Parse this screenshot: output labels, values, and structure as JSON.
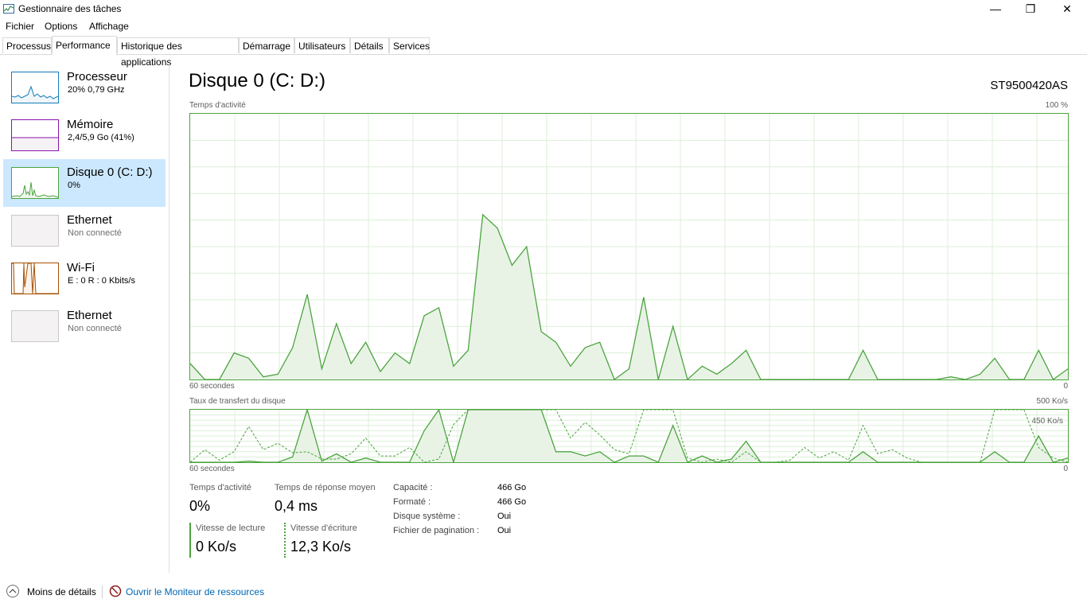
{
  "window": {
    "title": "Gestionnaire des tâches",
    "minimize": "—",
    "maximize": "❐",
    "close": "✕"
  },
  "menu": [
    "Fichier",
    "Options",
    "Affichage"
  ],
  "tabs": [
    "Processus",
    "Performance",
    "Historique des applications",
    "Démarrage",
    "Utilisateurs",
    "Détails",
    "Services"
  ],
  "active_tab": "Performance",
  "sidebar": [
    {
      "name": "Processeur",
      "sub": "20%  0,79 GHz",
      "color": "#117dbb"
    },
    {
      "name": "Mémoire",
      "sub": "2,4/5,9 Go (41%)",
      "color": "#8b12ae"
    },
    {
      "name": "Disque 0 (C: D:)",
      "sub": "0%",
      "color": "#4da43f"
    },
    {
      "name": "Ethernet",
      "sub": "Non connecté",
      "color": "#a0a0a0"
    },
    {
      "name": "Wi-Fi",
      "sub": "E : 0  R : 0 Kbits/s",
      "color": "#a74f01"
    },
    {
      "name": "Ethernet",
      "sub": "Non connecté",
      "color": "#a0a0a0"
    }
  ],
  "main": {
    "title": "Disque 0 (C: D:)",
    "model": "ST9500420AS",
    "activity_label": "Temps d'activité",
    "activity_max": "100 %",
    "seconds_label": "60 secondes",
    "zero": "0",
    "transfer_label": "Taux de transfert du disque",
    "transfer_max": "500 Ko/s",
    "transfer_line": "450 Ko/s"
  },
  "stats": {
    "active_time_label": "Temps d'activité",
    "active_time_value": "0%",
    "response_label": "Temps de réponse moyen",
    "response_value": "0,4 ms",
    "read_label": "Vitesse de lecture",
    "read_value": "0 Ko/s",
    "write_label": "Vitesse d'écriture",
    "write_value": "12,3 Ko/s"
  },
  "info": [
    {
      "label": "Capacité :",
      "value": "466 Go"
    },
    {
      "label": "Formaté :",
      "value": "466 Go"
    },
    {
      "label": "Disque système :",
      "value": "Oui"
    },
    {
      "label": "Fichier de pagination :",
      "value": "Oui"
    }
  ],
  "footer": {
    "less_details": "Moins de détails",
    "resource_monitor": "Ouvrir le Moniteur de ressources"
  },
  "chart_data": [
    {
      "type": "area",
      "title": "Temps d'activité",
      "xlabel": "60 secondes",
      "ylim": [
        0,
        100
      ],
      "x": [
        60,
        59,
        58,
        57,
        56,
        55,
        54,
        53,
        52,
        51,
        50,
        49,
        48,
        47,
        46,
        45,
        44,
        43,
        42,
        41,
        40,
        39,
        38,
        37,
        36,
        35,
        34,
        33,
        32,
        31,
        30,
        29,
        28,
        27,
        26,
        25,
        24,
        23,
        22,
        21,
        20,
        19,
        18,
        17,
        16,
        15,
        14,
        13,
        12,
        11,
        10,
        9,
        8,
        7,
        6,
        5,
        4,
        3,
        2,
        1,
        0
      ],
      "series": [
        {
          "values": [
            6,
            0,
            0,
            10,
            8,
            1,
            2,
            12,
            32,
            4,
            21,
            6,
            14,
            3,
            10,
            6,
            24,
            27,
            5,
            11,
            62,
            57,
            43,
            50,
            18,
            14,
            5,
            12,
            14,
            0,
            4,
            31,
            0,
            20,
            0,
            5,
            2,
            6,
            11,
            0,
            0,
            0,
            0,
            0,
            0,
            0,
            11,
            0,
            0,
            0,
            0,
            0,
            1,
            0,
            2,
            8,
            0,
            0,
            11,
            0,
            4
          ]
        }
      ]
    },
    {
      "type": "line",
      "title": "Taux de transfert du disque",
      "xlabel": "60 secondes",
      "ylim": [
        0,
        500
      ],
      "x": [
        60,
        59,
        58,
        57,
        56,
        55,
        54,
        53,
        52,
        51,
        50,
        49,
        48,
        47,
        46,
        45,
        44,
        43,
        42,
        41,
        40,
        39,
        38,
        37,
        36,
        35,
        34,
        33,
        32,
        31,
        30,
        29,
        28,
        27,
        26,
        25,
        24,
        23,
        22,
        21,
        20,
        19,
        18,
        17,
        16,
        15,
        14,
        13,
        12,
        11,
        10,
        9,
        8,
        7,
        6,
        5,
        4,
        3,
        2,
        1,
        0
      ],
      "series": [
        {
          "values": [
            0,
            0,
            0,
            0,
            10,
            0,
            0,
            50,
            500,
            10,
            80,
            0,
            40,
            0,
            0,
            0,
            300,
            500,
            0,
            500,
            500,
            500,
            500,
            500,
            500,
            100,
            100,
            60,
            100,
            0,
            60,
            60,
            0,
            350,
            0,
            60,
            0,
            30,
            200,
            0,
            0,
            0,
            0,
            0,
            0,
            0,
            100,
            0,
            0,
            0,
            0,
            0,
            0,
            0,
            0,
            100,
            0,
            0,
            250,
            0,
            40
          ]
        },
        {
          "values": [
            0,
            120,
            20,
            100,
            340,
            120,
            180,
            90,
            100,
            30,
            30,
            80,
            230,
            60,
            60,
            140,
            0,
            30,
            360,
            500,
            500,
            500,
            500,
            500,
            500,
            500,
            230,
            380,
            260,
            120,
            80,
            500,
            500,
            500,
            40,
            0,
            30,
            0,
            100,
            0,
            0,
            20,
            140,
            40,
            100,
            20,
            350,
            80,
            120,
            40,
            0,
            0,
            0,
            0,
            0,
            500,
            500,
            500,
            140,
            40,
            0
          ]
        }
      ]
    }
  ]
}
